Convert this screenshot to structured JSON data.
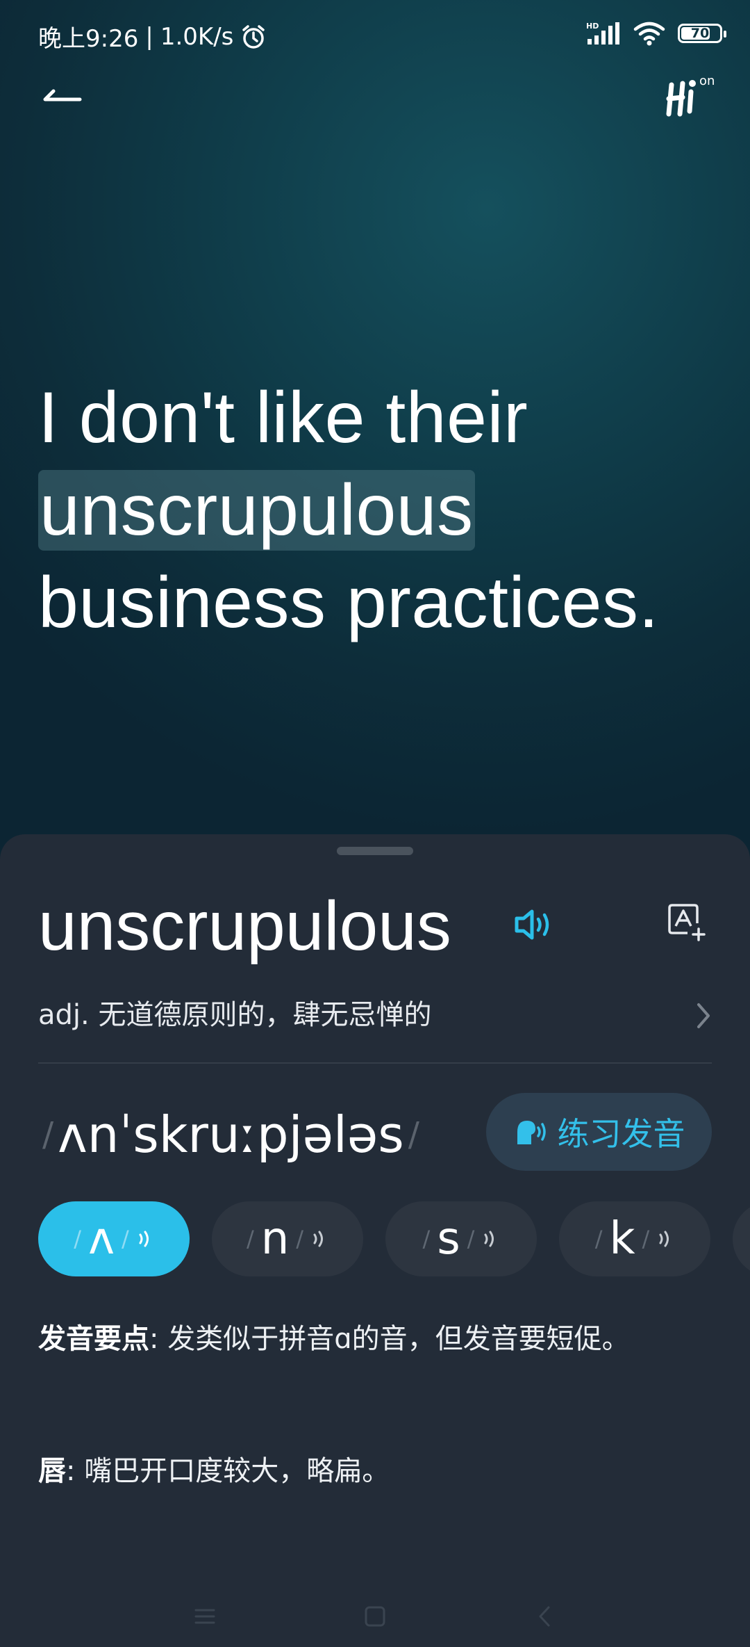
{
  "status_bar": {
    "time": "晚上9:26",
    "separator": "|",
    "net_speed": "1.0K/s",
    "signal_label": "HD",
    "battery_level": "70"
  },
  "sentence": {
    "before": " I don't like their ",
    "highlight": "unscrupulous",
    "after": " business practices."
  },
  "word_sheet": {
    "headword": "unscrupulous",
    "definition": "adj. 无道德原则的，肆无忌惮的",
    "phonetic": "ʌnˈskruːpjələs",
    "practice_label": "练习发音",
    "phonemes": [
      {
        "symbol": "ʌ",
        "active": true
      },
      {
        "symbol": "n",
        "active": false
      },
      {
        "symbol": "s",
        "active": false
      },
      {
        "symbol": "k",
        "active": false
      }
    ],
    "tips": {
      "label": "发音要点",
      "text": ": 发类似于拼音ɑ的音，但发音要短促。"
    },
    "lips": {
      "label": "唇",
      "text": ": 嘴巴开口度较大，略扁。"
    }
  },
  "colors": {
    "accent": "#2bbfe9",
    "sheet_bg": "#232c38",
    "chip_bg": "#2d3540"
  },
  "icons": [
    "back-arrow-icon",
    "hi-logo-icon",
    "speaker-icon",
    "add-vocab-icon",
    "chevron-right-icon",
    "mic-icon",
    "sound-wave-icon",
    "menu-icon",
    "home-icon",
    "nav-back-icon"
  ]
}
